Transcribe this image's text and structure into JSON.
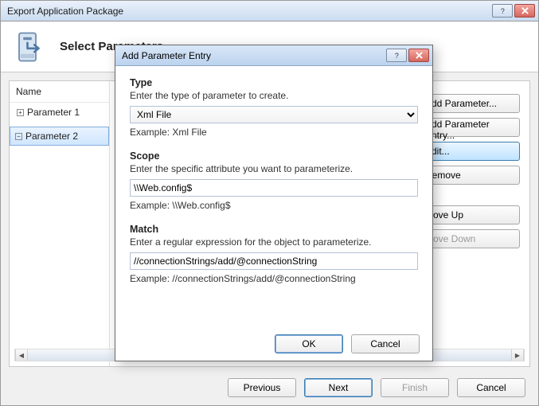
{
  "wizard": {
    "title": "Export Application Package",
    "heading": "Select Parameters"
  },
  "tree": {
    "header": "Name",
    "items": [
      {
        "label": "Parameter 1",
        "selected": false
      },
      {
        "label": "Parameter 2",
        "selected": true
      }
    ]
  },
  "commands": {
    "add_parameter": "Add Parameter...",
    "add_entry": "Add Parameter Entry...",
    "edit": "Edit...",
    "remove": "Remove",
    "move_up": "Move Up",
    "move_down": "Move Down"
  },
  "footer": {
    "previous": "Previous",
    "next": "Next",
    "finish": "Finish",
    "cancel": "Cancel"
  },
  "dialog": {
    "title": "Add Parameter Entry",
    "type": {
      "label": "Type",
      "desc": "Enter the type of parameter to create.",
      "value": "Xml File",
      "example": "Example: Xml File"
    },
    "scope": {
      "label": "Scope",
      "desc": "Enter the specific attribute you want to parameterize.",
      "value": "\\\\Web.config$",
      "example": "Example: \\\\Web.config$"
    },
    "match": {
      "label": "Match",
      "desc": "Enter a regular expression for the object to parameterize.",
      "value": "//connectionStrings/add/@connectionString",
      "example": "Example: //connectionStrings/add/@connectionString"
    },
    "ok": "OK",
    "cancel": "Cancel"
  }
}
